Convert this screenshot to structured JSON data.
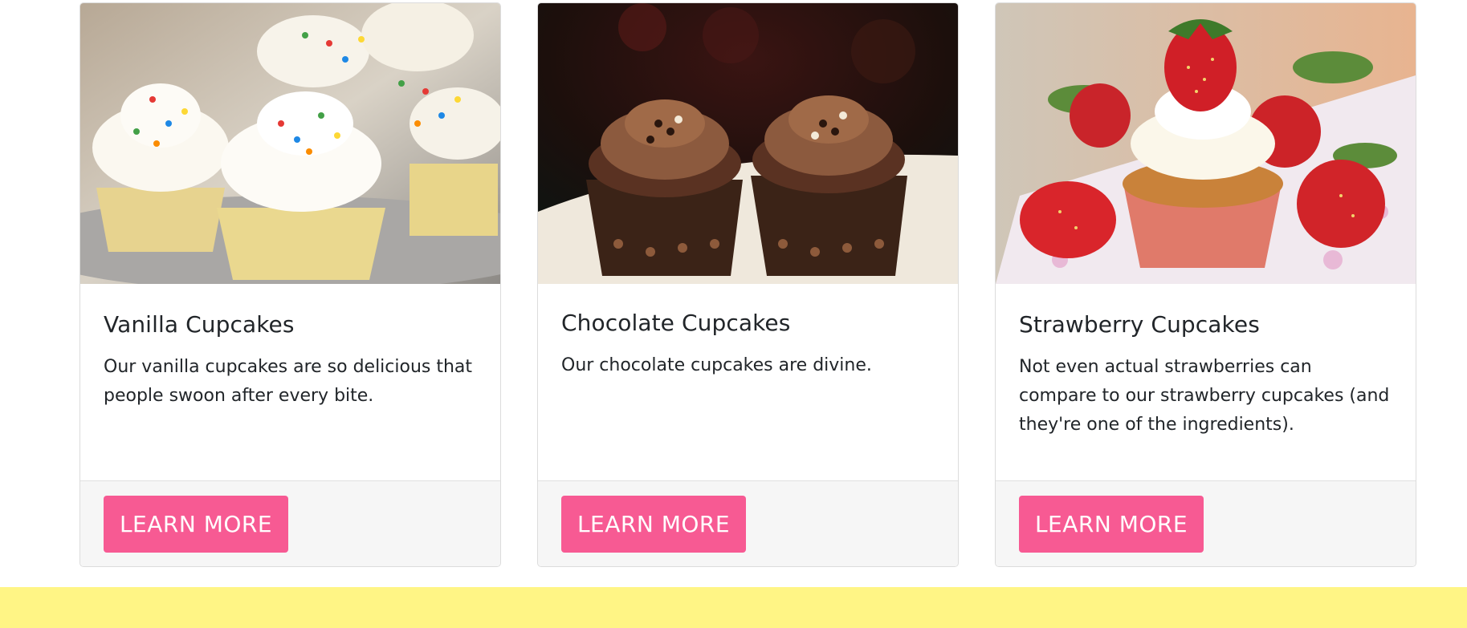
{
  "colors": {
    "button_bg": "#f75a93",
    "button_text": "#ffffff",
    "footer_bg": "#f6f6f6",
    "band_bg": "#fff585"
  },
  "cards": [
    {
      "image": "vanilla-cupcakes-image",
      "title": "Vanilla Cupcakes",
      "text": "Our vanilla cupcakes are so delicious that people swoon after every bite.",
      "button_label": "LEARN MORE"
    },
    {
      "image": "chocolate-cupcakes-image",
      "title": "Chocolate Cupcakes",
      "text": "Our chocolate cupcakes are divine.",
      "button_label": "LEARN MORE"
    },
    {
      "image": "strawberry-cupcakes-image",
      "title": "Strawberry Cupcakes",
      "text": "Not even actual strawberries can compare to our strawberry cupcakes (and they're one of the ingredients).",
      "button_label": "LEARN MORE"
    }
  ]
}
